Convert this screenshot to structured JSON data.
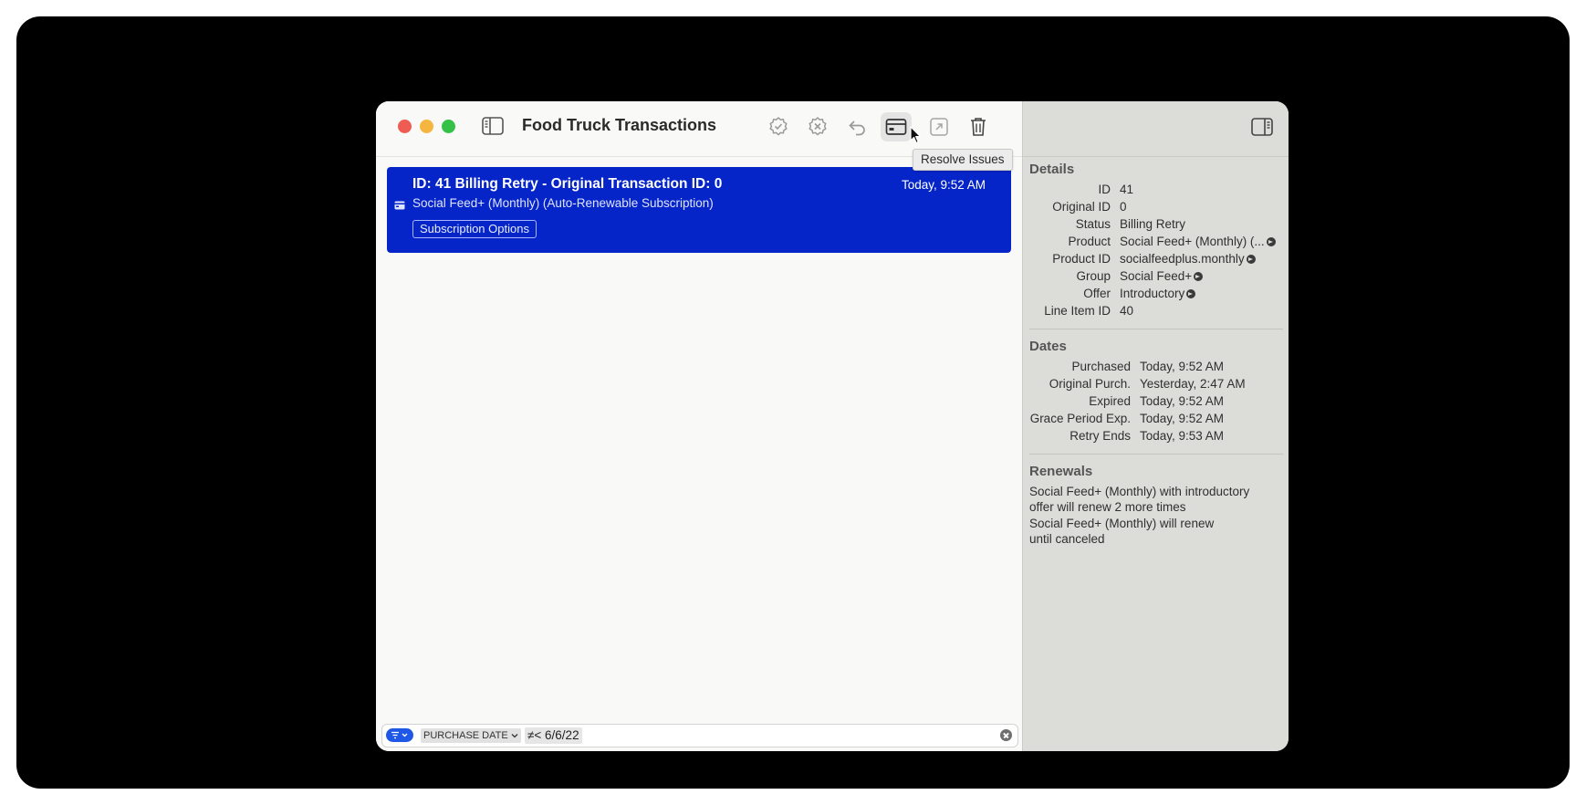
{
  "window": {
    "title": "Food Truck Transactions"
  },
  "toolbar": {
    "tooltip": "Resolve Issues",
    "buttons": [
      "approve-icon",
      "decline-icon",
      "refund-icon",
      "credit-card-icon",
      "external-icon",
      "trash-icon"
    ]
  },
  "transaction": {
    "title": "ID: 41 Billing Retry - Original Transaction ID: 0",
    "date": "Today, 9:52 AM",
    "subtitle": "Social Feed+ (Monthly) (Auto-Renewable Subscription)",
    "options_label": "Subscription Options"
  },
  "filter": {
    "field": "PURCHASE DATE",
    "condition": "≠< 6/6/22"
  },
  "inspector": {
    "details": {
      "heading": "Details",
      "rows": [
        {
          "label": "ID",
          "value": "41",
          "link": false
        },
        {
          "label": "Original ID",
          "value": "0",
          "link": false
        },
        {
          "label": "Status",
          "value": "Billing Retry",
          "link": false
        },
        {
          "label": "Product",
          "value": "Social Feed+ (Monthly) (...",
          "link": true
        },
        {
          "label": "Product ID",
          "value": "socialfeedplus.monthly",
          "link": true
        },
        {
          "label": "Group",
          "value": "Social Feed+",
          "link": true
        },
        {
          "label": "Offer",
          "value": "Introductory",
          "link": true
        },
        {
          "label": "Line Item ID",
          "value": "40",
          "link": false
        }
      ]
    },
    "dates": {
      "heading": "Dates",
      "rows": [
        {
          "label": "Purchased",
          "value": "Today, 9:52 AM"
        },
        {
          "label": "Original Purch.",
          "value": "Yesterday, 2:47 AM"
        },
        {
          "label": "Expired",
          "value": "Today, 9:52 AM"
        },
        {
          "label": "Grace Period Exp.",
          "value": "Today, 9:52 AM"
        },
        {
          "label": "Retry Ends",
          "value": "Today, 9:53 AM"
        }
      ]
    },
    "renewals": {
      "heading": "Renewals",
      "items": [
        "Social Feed+ (Monthly) with introductory offer will renew 2 more times",
        "Social Feed+ (Monthly) will renew until canceled"
      ]
    }
  }
}
